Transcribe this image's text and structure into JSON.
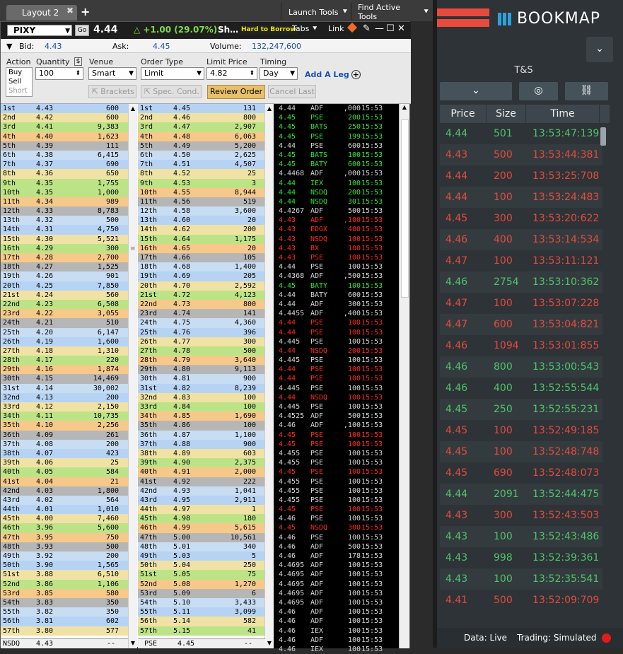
{
  "top": {
    "tab": "Layout 2",
    "launch": "Launch Tools",
    "find": "Find Active Tools"
  },
  "quote": {
    "symbol": "PIXY",
    "go": "Go",
    "last": "4.44",
    "change": "+1.00 (29.07%)",
    "name": "Sh…",
    "htb": "Hard to Borrow",
    "tabs": "Tabs",
    "link": "Link"
  },
  "bid": {
    "bid_label": "Bid:",
    "bid": "4.43",
    "ask_label": "Ask:",
    "ask": "4.45",
    "vol_label": "Volume:",
    "vol": "132,247,600"
  },
  "order": {
    "action_label": "Action",
    "qty_label": "Quantity",
    "venue_label": "Venue",
    "type_label": "Order Type",
    "limit_label": "Limit Price",
    "timing_label": "Timing",
    "actions": [
      "Buy",
      "Sell",
      "Short"
    ],
    "qty": "100",
    "venue": "Smart",
    "type": "Limit",
    "limit": "4.82",
    "timing": "Day",
    "add_leg": "Add A Leg",
    "brackets": "Brackets",
    "spec": "Spec. Cond.",
    "review": "Review Order",
    "cancel": "Cancel Last"
  },
  "colors": {
    "bookmap_red": "#e84b3c",
    "bookmap_blue": "#29a3e0",
    "up": "#4fc36b",
    "down": "#e34b3e",
    "ts_green": "#2ee832",
    "ts_red": "#ff2a1f"
  },
  "bids": [
    [
      "1st",
      "4.43",
      "600"
    ],
    [
      "2nd",
      "4.42",
      "600"
    ],
    [
      "3rd",
      "4.41",
      "9,383"
    ],
    [
      "4th",
      "4.40",
      "1,623"
    ],
    [
      "5th",
      "4.39",
      "111"
    ],
    [
      "6th",
      "4.38",
      "6,415"
    ],
    [
      "7th",
      "4.37",
      "690"
    ],
    [
      "8th",
      "4.36",
      "650"
    ],
    [
      "9th",
      "4.35",
      "1,755"
    ],
    [
      "10th",
      "4.35",
      "1,000"
    ],
    [
      "11th",
      "4.34",
      "989"
    ],
    [
      "12th",
      "4.33",
      "8,783"
    ],
    [
      "13th",
      "4.32",
      "500"
    ],
    [
      "14th",
      "4.31",
      "4,750"
    ],
    [
      "15th",
      "4.30",
      "5,521"
    ],
    [
      "16th",
      "4.29",
      "300"
    ],
    [
      "17th",
      "4.28",
      "2,700"
    ],
    [
      "18th",
      "4.27",
      "1,525"
    ],
    [
      "19th",
      "4.26",
      "901"
    ],
    [
      "20th",
      "4.25",
      "7,850"
    ],
    [
      "21st",
      "4.24",
      "560"
    ],
    [
      "22nd",
      "4.23",
      "6,508"
    ],
    [
      "23rd",
      "4.22",
      "3,055"
    ],
    [
      "24th",
      "4.21",
      "510"
    ],
    [
      "25th",
      "4.20",
      "6,147"
    ],
    [
      "26th",
      "4.19",
      "1,600"
    ],
    [
      "27th",
      "4.18",
      "1,310"
    ],
    [
      "28th",
      "4.17",
      "220"
    ],
    [
      "29th",
      "4.16",
      "1,874"
    ],
    [
      "30th",
      "4.15",
      "14,469"
    ],
    [
      "31st",
      "4.14",
      "30,002"
    ],
    [
      "32nd",
      "4.13",
      "200"
    ],
    [
      "33rd",
      "4.12",
      "2,150"
    ],
    [
      "34th",
      "4.11",
      "10,735"
    ],
    [
      "35th",
      "4.10",
      "2,256"
    ],
    [
      "36th",
      "4.09",
      "261"
    ],
    [
      "37th",
      "4.08",
      "200"
    ],
    [
      "38th",
      "4.07",
      "423"
    ],
    [
      "39th",
      "4.06",
      "25"
    ],
    [
      "40th",
      "4.05",
      "584"
    ],
    [
      "41st",
      "4.04",
      "21"
    ],
    [
      "42nd",
      "4.03",
      "1,800"
    ],
    [
      "43rd",
      "4.02",
      "564"
    ],
    [
      "44th",
      "4.01",
      "1,010"
    ],
    [
      "45th",
      "4.00",
      "7,460"
    ],
    [
      "46th",
      "3.96",
      "5,600"
    ],
    [
      "47th",
      "3.95",
      "750"
    ],
    [
      "48th",
      "3.93",
      "500"
    ],
    [
      "49th",
      "3.92",
      "200"
    ],
    [
      "50th",
      "3.90",
      "1,565"
    ],
    [
      "51st",
      "3.88",
      "6,510"
    ],
    [
      "52nd",
      "3.86",
      "1,106"
    ],
    [
      "53rd",
      "3.85",
      "580"
    ],
    [
      "54th",
      "3.83",
      "350"
    ],
    [
      "55th",
      "3.82",
      "350"
    ],
    [
      "56th",
      "3.81",
      "602"
    ],
    [
      "57th",
      "3.80",
      "577"
    ]
  ],
  "asks": [
    [
      "1st",
      "4.45",
      "131"
    ],
    [
      "2nd",
      "4.46",
      "800"
    ],
    [
      "3rd",
      "4.47",
      "2,907"
    ],
    [
      "4th",
      "4.48",
      "6,063"
    ],
    [
      "5th",
      "4.49",
      "5,200"
    ],
    [
      "6th",
      "4.50",
      "2,625"
    ],
    [
      "7th",
      "4.51",
      "4,507"
    ],
    [
      "8th",
      "4.52",
      "25"
    ],
    [
      "9th",
      "4.53",
      "3"
    ],
    [
      "10th",
      "4.55",
      "8,944"
    ],
    [
      "11th",
      "4.56",
      "519"
    ],
    [
      "12th",
      "4.58",
      "3,600"
    ],
    [
      "13th",
      "4.60",
      "20"
    ],
    [
      "14th",
      "4.62",
      "200"
    ],
    [
      "15th",
      "4.64",
      "1,175"
    ],
    [
      "16th",
      "4.65",
      "20"
    ],
    [
      "17th",
      "4.66",
      "105"
    ],
    [
      "18th",
      "4.68",
      "1,400"
    ],
    [
      "19th",
      "4.69",
      "205"
    ],
    [
      "20th",
      "4.70",
      "2,592"
    ],
    [
      "21st",
      "4.72",
      "4,123"
    ],
    [
      "22nd",
      "4.73",
      "800"
    ],
    [
      "23rd",
      "4.74",
      "141"
    ],
    [
      "24th",
      "4.75",
      "4,360"
    ],
    [
      "25th",
      "4.76",
      "396"
    ],
    [
      "26th",
      "4.77",
      "300"
    ],
    [
      "27th",
      "4.78",
      "500"
    ],
    [
      "28th",
      "4.79",
      "3,640"
    ],
    [
      "29th",
      "4.80",
      "9,113"
    ],
    [
      "30th",
      "4.81",
      "900"
    ],
    [
      "31st",
      "4.82",
      "8,239"
    ],
    [
      "32nd",
      "4.83",
      "100"
    ],
    [
      "33rd",
      "4.84",
      "100"
    ],
    [
      "34th",
      "4.85",
      "1,690"
    ],
    [
      "35th",
      "4.86",
      "100"
    ],
    [
      "36th",
      "4.87",
      "1,100"
    ],
    [
      "37th",
      "4.88",
      "900"
    ],
    [
      "38th",
      "4.89",
      "603"
    ],
    [
      "39th",
      "4.90",
      "2,375"
    ],
    [
      "40th",
      "4.91",
      "2,000"
    ],
    [
      "41st",
      "4.92",
      "222"
    ],
    [
      "42nd",
      "4.93",
      "1,041"
    ],
    [
      "43rd",
      "4.95",
      "2,911"
    ],
    [
      "44th",
      "4.97",
      "1"
    ],
    [
      "45th",
      "4.98",
      "180"
    ],
    [
      "46th",
      "4.99",
      "5,615"
    ],
    [
      "47th",
      "5.00",
      "10,561"
    ],
    [
      "48th",
      "5.01",
      "340"
    ],
    [
      "49th",
      "5.03",
      "5"
    ],
    [
      "50th",
      "5.04",
      "250"
    ],
    [
      "51st",
      "5.05",
      "75"
    ],
    [
      "52nd",
      "5.08",
      "1,270"
    ],
    [
      "53rd",
      "5.09",
      "6"
    ],
    [
      "54th",
      "5.10",
      "3,433"
    ],
    [
      "55th",
      "5.11",
      "3,099"
    ],
    [
      "56th",
      "5.14",
      "582"
    ],
    [
      "57th",
      "5.15",
      "41"
    ]
  ],
  "bid_bottom": [
    "NSDQ",
    "4.43",
    "--"
  ],
  "ask_bottom": [
    "PSE",
    "4.45",
    "--"
  ],
  "ts": [
    [
      "4.44",
      "ADF",
      ",000",
      "15:53",
      "w"
    ],
    [
      "4.45",
      "PSE",
      "200",
      "15:53",
      "g"
    ],
    [
      "4.45",
      "BATS",
      "250",
      "15:53",
      "g"
    ],
    [
      "4.45",
      "PSE",
      "199",
      "15:53",
      "g"
    ],
    [
      "4.44",
      "PSE",
      "600",
      "15:53",
      "w"
    ],
    [
      "4.45",
      "BATS",
      "100",
      "15:53",
      "g"
    ],
    [
      "4.45",
      "BATY",
      "600",
      "15:53",
      "g"
    ],
    [
      "4.4468",
      "ADF",
      ",000",
      "15:53",
      "w"
    ],
    [
      "4.44",
      "IEX",
      "100",
      "15:53",
      "g"
    ],
    [
      "4.44",
      "NSDQ",
      "200",
      "15:53",
      "g"
    ],
    [
      "4.44",
      "NSDQ",
      "301",
      "15:53",
      "g"
    ],
    [
      "4.4267",
      "ADF",
      "500",
      "15:53",
      "w"
    ],
    [
      "4.43",
      "ADF",
      ",100",
      "15:53",
      "r"
    ],
    [
      "4.43",
      "EDGX",
      "400",
      "15:53",
      "r"
    ],
    [
      "4.43",
      "NSDQ",
      "100",
      "15:53",
      "r"
    ],
    [
      "4.43",
      "BX",
      "100",
      "15:53",
      "r"
    ],
    [
      "4.43",
      "PSE",
      "100",
      "15:53",
      "r"
    ],
    [
      "4.44",
      "PSE",
      "100",
      "15:53",
      "w"
    ],
    [
      "4.4368",
      "ADF",
      ",500",
      "15:53",
      "w"
    ],
    [
      "4.45",
      "BATY",
      "100",
      "15:53",
      "g"
    ],
    [
      "4.44",
      "BATY",
      "600",
      "15:53",
      "w"
    ],
    [
      "4.44",
      "ADF",
      "300",
      "15:53",
      "w"
    ],
    [
      "4.4455",
      "ADF",
      ",400",
      "15:53",
      "w"
    ],
    [
      "4.44",
      "PSE",
      "100",
      "15:53",
      "r"
    ],
    [
      "4.44",
      "PSE",
      "100",
      "15:53",
      "r"
    ],
    [
      "4.445",
      "PSE",
      "100",
      "15:53",
      "w"
    ],
    [
      "4.44",
      "NSDQ",
      "200",
      "15:53",
      "r"
    ],
    [
      "4.445",
      "PSE",
      "100",
      "15:53",
      "w"
    ],
    [
      "4.44",
      "PSE",
      "100",
      "15:53",
      "r"
    ],
    [
      "4.44",
      "PSE",
      "100",
      "15:53",
      "r"
    ],
    [
      "4.445",
      "PSE",
      "100",
      "15:53",
      "w"
    ],
    [
      "4.44",
      "NSDQ",
      "100",
      "15:53",
      "r"
    ],
    [
      "4.445",
      "PSE",
      "100",
      "15:53",
      "w"
    ],
    [
      "4.4525",
      "ADF",
      "500",
      "15:53",
      "w"
    ],
    [
      "4.46",
      "ADF",
      ",100",
      "15:53",
      "w"
    ],
    [
      "4.45",
      "PSE",
      "100",
      "15:53",
      "r"
    ],
    [
      "4.45",
      "PSE",
      "100",
      "15:53",
      "r"
    ],
    [
      "4.455",
      "PSE",
      "100",
      "15:53",
      "w"
    ],
    [
      "4.455",
      "PSE",
      "100",
      "15:53",
      "w"
    ],
    [
      "4.45",
      "PSE",
      "100",
      "15:53",
      "r"
    ],
    [
      "4.455",
      "PSE",
      "100",
      "15:53",
      "w"
    ],
    [
      "4.455",
      "PSE",
      "100",
      "15:53",
      "w"
    ],
    [
      "4.455",
      "PSE",
      "100",
      "15:53",
      "w"
    ],
    [
      "4.45",
      "PSE",
      "100",
      "15:53",
      "r"
    ],
    [
      "4.46",
      "PSE",
      "100",
      "15:53",
      "w"
    ],
    [
      "4.45",
      "NSDQ",
      "300",
      "15:53",
      "r"
    ],
    [
      "4.46",
      "PSE",
      "100",
      "15:53",
      "w"
    ],
    [
      "4.46",
      "ADF",
      "500",
      "15:53",
      "w"
    ],
    [
      "4.46",
      "ADF",
      "178",
      "15:53",
      "w"
    ],
    [
      "4.4695",
      "ADF",
      "100",
      "15:53",
      "w"
    ],
    [
      "4.4695",
      "ADF",
      "100",
      "15:53",
      "w"
    ],
    [
      "4.4695",
      "ADF",
      "100",
      "15:53",
      "w"
    ],
    [
      "4.4695",
      "ADF",
      "100",
      "15:53",
      "w"
    ],
    [
      "4.4695",
      "ADF",
      "100",
      "15:53",
      "w"
    ],
    [
      "4.46",
      "ADF",
      "100",
      "15:53",
      "w"
    ],
    [
      "4.46",
      "ADF",
      "100",
      "15:53",
      "w"
    ],
    [
      "4.46",
      "IEX",
      "100",
      "15:53",
      "w"
    ],
    [
      "4.46",
      "ADF",
      "100",
      "15:53",
      "w"
    ],
    [
      "4.46",
      "IEX",
      "100",
      "15:53",
      "w"
    ]
  ],
  "bookmap": {
    "title": "BOOKMAP",
    "ts_label": "T&S",
    "cols": [
      "Price",
      "Size",
      "Time"
    ],
    "rows": [
      [
        "4.44",
        "501",
        "13:53:47:139",
        "u"
      ],
      [
        "4.43",
        "500",
        "13:53:44:381",
        "d"
      ],
      [
        "4.44",
        "200",
        "13:53:25:708",
        "d"
      ],
      [
        "4.44",
        "100",
        "13:53:24:483",
        "d"
      ],
      [
        "4.45",
        "300",
        "13:53:20:622",
        "d"
      ],
      [
        "4.46",
        "400",
        "13:53:14:534",
        "d"
      ],
      [
        "4.47",
        "100",
        "13:53:11:121",
        "d"
      ],
      [
        "4.46",
        "2754",
        "13:53:10:362",
        "u"
      ],
      [
        "4.47",
        "100",
        "13:53:07:228",
        "d"
      ],
      [
        "4.47",
        "600",
        "13:53:04:821",
        "d"
      ],
      [
        "4.46",
        "1094",
        "13:53:01:855",
        "d"
      ],
      [
        "4.46",
        "800",
        "13:53:00:543",
        "u"
      ],
      [
        "4.46",
        "400",
        "13:52:55:544",
        "u"
      ],
      [
        "4.45",
        "250",
        "13:52:55:231",
        "u"
      ],
      [
        "4.45",
        "100",
        "13:52:49:185",
        "d"
      ],
      [
        "4.45",
        "100",
        "13:52:48:748",
        "d"
      ],
      [
        "4.45",
        "690",
        "13:52:48:073",
        "d"
      ],
      [
        "4.44",
        "2091",
        "13:52:44:475",
        "u"
      ],
      [
        "4.43",
        "300",
        "13:52:43:503",
        "d"
      ],
      [
        "4.43",
        "100",
        "13:52:43:486",
        "u"
      ],
      [
        "4.43",
        "998",
        "13:52:39:361",
        "u"
      ],
      [
        "4.43",
        "100",
        "13:52:35:541",
        "u"
      ],
      [
        "4.41",
        "500",
        "13:52:09:709",
        "d"
      ]
    ],
    "data_status": "Data: Live",
    "trading_status": "Trading: Simulated"
  }
}
